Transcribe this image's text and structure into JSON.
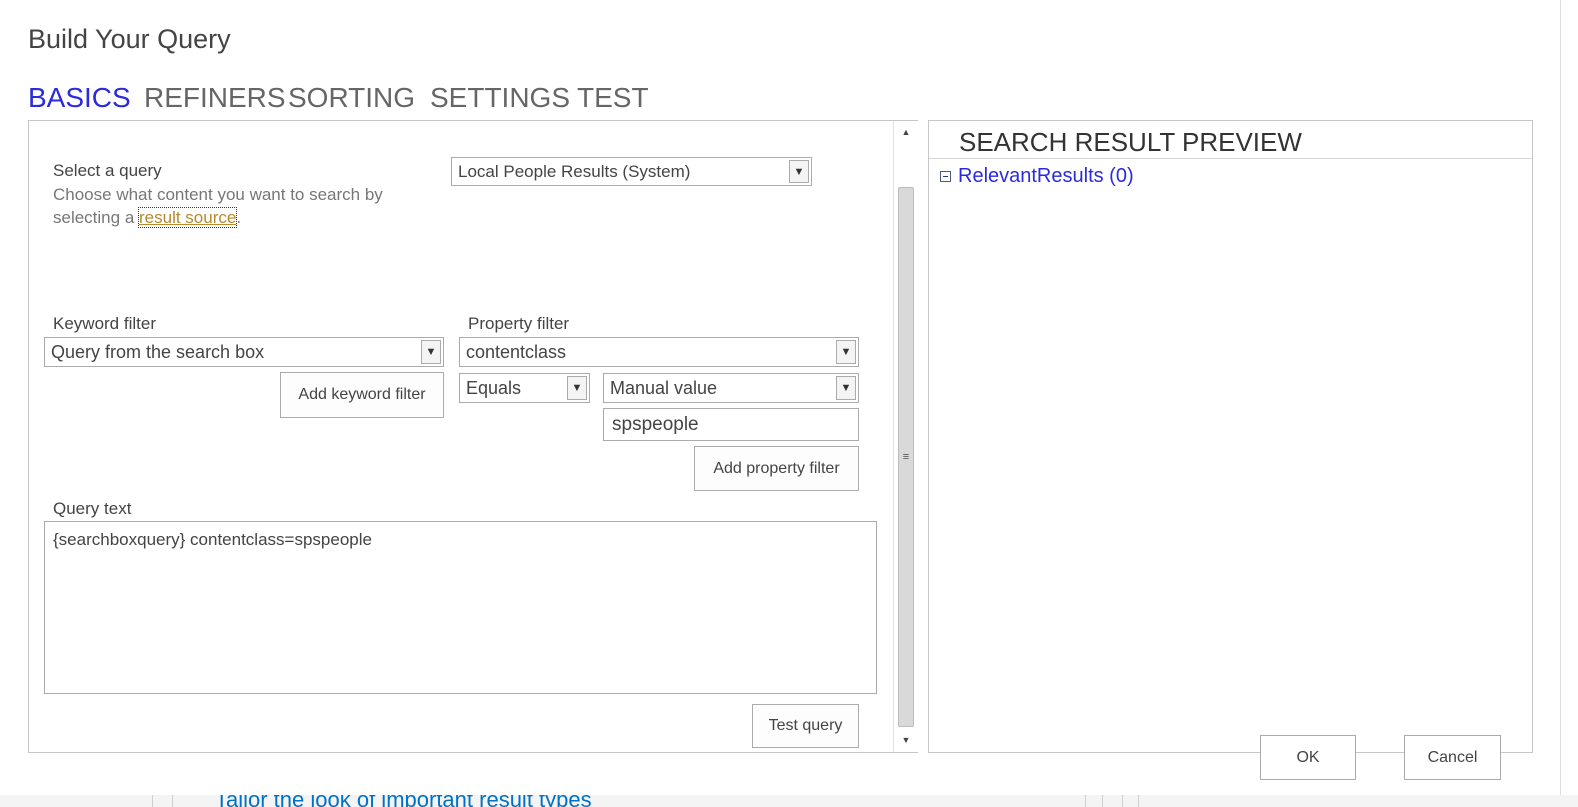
{
  "dialog": {
    "title": "Build Your Query"
  },
  "tabs": [
    {
      "label": "BASICS",
      "active": true
    },
    {
      "label": "REFINERS",
      "active": false
    },
    {
      "label": "SORTING",
      "active": false
    },
    {
      "label": "SETTINGS",
      "active": false
    },
    {
      "label": "TEST",
      "active": false
    }
  ],
  "select_query": {
    "label": "Select a query",
    "description_prefix": "Choose what content you want to search by selecting a ",
    "link_text": "result source",
    "description_suffix": ".",
    "selected": "Local People Results (System)"
  },
  "keyword_filter": {
    "label": "Keyword filter",
    "selected": "Query from the search box",
    "add_button": "Add keyword filter"
  },
  "property_filter": {
    "label": "Property filter",
    "property_selected": "contentclass",
    "operator_selected": "Equals",
    "value_type_selected": "Manual value",
    "value": "spspeople",
    "add_button": "Add property filter"
  },
  "query_text": {
    "label": "Query text",
    "value": "{searchboxquery} contentclass=spspeople"
  },
  "test_query_button": "Test query",
  "preview": {
    "title": "SEARCH RESULT PREVIEW",
    "relevant_results": "RelevantResults (0)"
  },
  "footer": {
    "ok_label": "OK",
    "cancel_label": "Cancel"
  },
  "background_page": {
    "text": "Tailor the look of important result types"
  },
  "colors": {
    "accent": "#2b2bdc",
    "link": "#b58a2e",
    "border": "#ababab"
  }
}
